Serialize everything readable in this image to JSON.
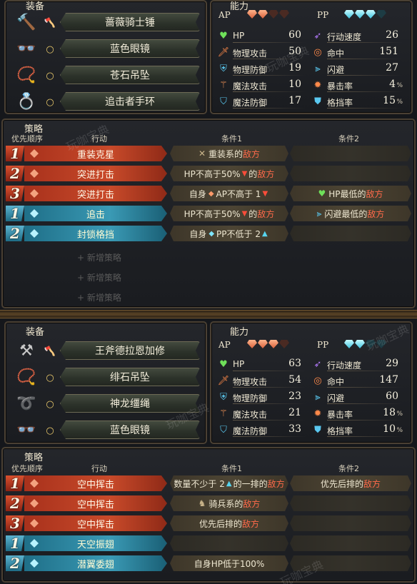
{
  "panel1": {
    "equipment": {
      "title": "装备",
      "items": [
        {
          "type_icon": "axe-icon",
          "icon": "hammer-icon",
          "name": "蔷薇骑士锤"
        },
        {
          "type_icon": "ring-icon",
          "icon": "glasses-icon",
          "name": "蓝色眼镜"
        },
        {
          "type_icon": "ring-icon",
          "icon": "pendant-icon",
          "name": "苍石吊坠"
        },
        {
          "type_icon": "ring-icon",
          "icon": "bracelet-icon",
          "name": "追击者手环"
        }
      ]
    },
    "ability": {
      "title": "能力",
      "ap_label": "AP",
      "pp_label": "PP",
      "ap_gems": {
        "filled": 2,
        "total": 4
      },
      "pp_gems": {
        "filled": 3,
        "total": 4
      },
      "left": [
        {
          "icon": "heart-icon",
          "label": "HP",
          "value": "60"
        },
        {
          "icon": "sword-icon",
          "label": "物理攻击",
          "value": "50"
        },
        {
          "icon": "armor-icon",
          "label": "物理防御",
          "value": "19"
        },
        {
          "icon": "wand-icon",
          "label": "魔法攻击",
          "value": "10"
        },
        {
          "icon": "magic-shield-icon",
          "label": "魔法防御",
          "value": "17"
        }
      ],
      "right": [
        {
          "icon": "speed-icon",
          "label": "行动速度",
          "value": "26",
          "pct": ""
        },
        {
          "icon": "target-icon",
          "label": "命中",
          "value": "151",
          "pct": ""
        },
        {
          "icon": "dodge-icon",
          "label": "闪避",
          "value": "27",
          "pct": ""
        },
        {
          "icon": "crit-icon",
          "label": "暴击率",
          "value": "4",
          "pct": "%"
        },
        {
          "icon": "block-icon",
          "label": "格挡率",
          "value": "15",
          "pct": "%"
        }
      ]
    },
    "tactics": {
      "title": "策略",
      "headers": {
        "order": "优先顺序",
        "action": "行动",
        "cond1": "条件1",
        "cond2": "条件2"
      },
      "rows": [
        {
          "num": "1",
          "color": "red",
          "action": "重装克星",
          "c1_pre": "重装系的",
          "c1_enemy": "敌方",
          "c1_icon": "✕",
          "c2": ""
        },
        {
          "num": "2",
          "color": "red",
          "action": "突进打击",
          "c1_pre": "HP不高于50%",
          "c1_tri": "▼",
          "c1_post": "的",
          "c1_enemy": "敌方",
          "c2": ""
        },
        {
          "num": "3",
          "color": "red",
          "action": "突进打击",
          "c1_pre": "自身",
          "c1_mid": "AP不高于 1",
          "c1_tri": "▼",
          "c2_pre": "HP最低的",
          "c2_enemy": "敌方"
        },
        {
          "num": "1",
          "color": "blue",
          "action": "追击",
          "c1_pre": "HP不高于50%",
          "c1_tri": "▼",
          "c1_post": "的",
          "c1_enemy": "敌方",
          "c2_pre": "闪避最低的",
          "c2_enemy": "敌方"
        },
        {
          "num": "2",
          "color": "blue",
          "action": "封锁格挡",
          "c1_pre": "自身",
          "c1_mid": "PP不低于 2",
          "c1_tri": "▲",
          "c2": ""
        }
      ],
      "add_label": "+ 新增策略"
    }
  },
  "panel2": {
    "equipment": {
      "title": "装备",
      "items": [
        {
          "type_icon": "axe-icon",
          "icon": "axe-weapon-icon",
          "name": "王斧德拉恩加修"
        },
        {
          "type_icon": "ring-icon",
          "icon": "pendant-icon",
          "name": "绯石吊坠"
        },
        {
          "type_icon": "ring-icon",
          "icon": "rope-icon",
          "name": "神龙缰绳"
        },
        {
          "type_icon": "ring-icon",
          "icon": "glasses-icon",
          "name": "蓝色眼镜"
        }
      ]
    },
    "ability": {
      "title": "能力",
      "ap_label": "AP",
      "pp_label": "PP",
      "ap_gems": {
        "filled": 3,
        "total": 4
      },
      "pp_gems": {
        "filled": 2,
        "total": 4
      },
      "left": [
        {
          "icon": "heart-icon",
          "label": "HP",
          "value": "63"
        },
        {
          "icon": "sword-icon",
          "label": "物理攻击",
          "value": "54"
        },
        {
          "icon": "armor-icon",
          "label": "物理防御",
          "value": "23"
        },
        {
          "icon": "wand-icon",
          "label": "魔法攻击",
          "value": "21"
        },
        {
          "icon": "magic-shield-icon",
          "label": "魔法防御",
          "value": "33"
        }
      ],
      "right": [
        {
          "icon": "speed-icon",
          "label": "行动速度",
          "value": "29",
          "pct": ""
        },
        {
          "icon": "target-icon",
          "label": "命中",
          "value": "147",
          "pct": ""
        },
        {
          "icon": "dodge-icon",
          "label": "闪避",
          "value": "60",
          "pct": ""
        },
        {
          "icon": "crit-icon",
          "label": "暴击率",
          "value": "18",
          "pct": "%"
        },
        {
          "icon": "block-icon",
          "label": "格挡率",
          "value": "10",
          "pct": "%"
        }
      ]
    },
    "tactics": {
      "title": "策略",
      "headers": {
        "order": "优先顺序",
        "action": "行动",
        "cond1": "条件1",
        "cond2": "条件2"
      },
      "rows": [
        {
          "num": "1",
          "color": "red",
          "action": "空中挥击",
          "c1_pre": "数量不少于 2",
          "c1_tri": "▲",
          "c1_post": "的一排的",
          "c1_enemy": "敌方",
          "c2_pre": "优先后排的",
          "c2_enemy": "敌方"
        },
        {
          "num": "2",
          "color": "red",
          "action": "空中挥击",
          "c1_pre": "骑兵系的",
          "c1_enemy": "敌方",
          "c1_icon": "♞",
          "c2": ""
        },
        {
          "num": "3",
          "color": "red",
          "action": "空中挥击",
          "c1_pre": "优先后排的",
          "c1_enemy": "敌方",
          "c2": ""
        },
        {
          "num": "1",
          "color": "blue",
          "action": "天空振翅",
          "c1_pre": "",
          "c2": ""
        },
        {
          "num": "2",
          "color": "blue",
          "action": "潜翼委翅",
          "c1_pre": "自身HP低于100%",
          "c2": ""
        }
      ]
    }
  },
  "watermark": "玩咖宝典"
}
